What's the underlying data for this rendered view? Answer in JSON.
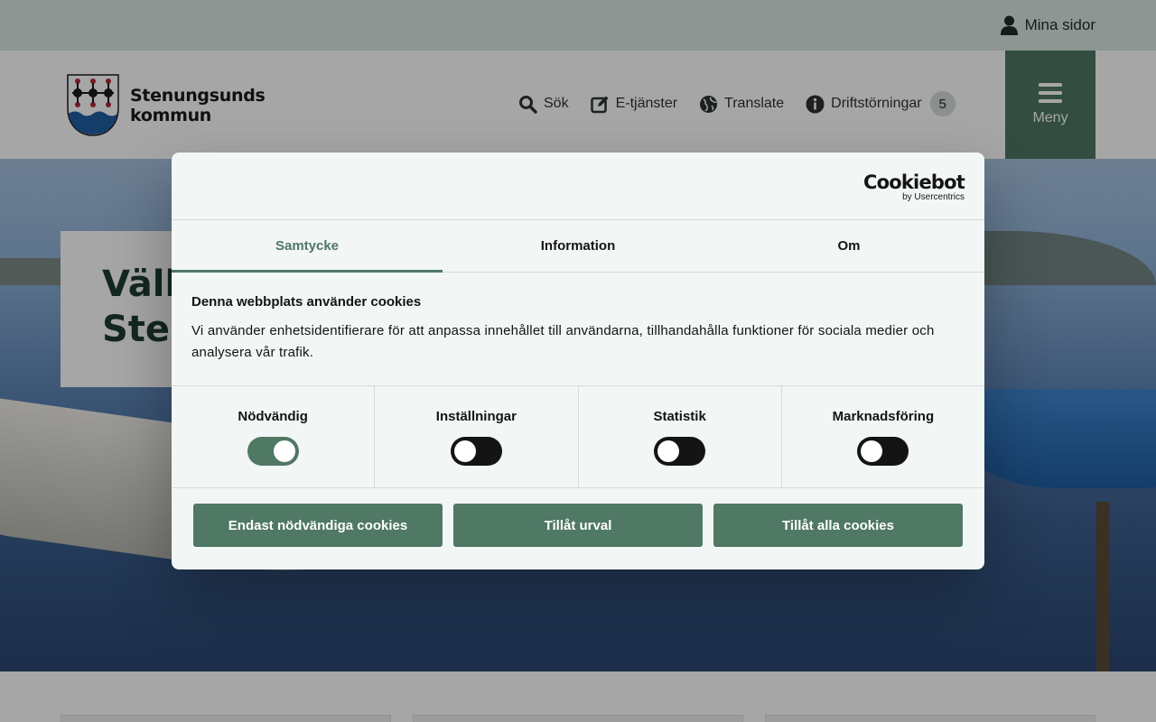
{
  "topbar": {
    "mina_sidor": "Mina sidor"
  },
  "logo": {
    "line1": "Stenungsunds",
    "line2": "kommun"
  },
  "nav": {
    "items": [
      {
        "label": "Sök",
        "icon": "search-icon"
      },
      {
        "label": "E-tjänster",
        "icon": "edit-icon"
      },
      {
        "label": "Translate",
        "icon": "globe-icon"
      },
      {
        "label": "Driftstörningar",
        "icon": "info-icon"
      }
    ],
    "driftstorningar_count": "5",
    "menu_label": "Meny"
  },
  "hero": {
    "line1": "Välk",
    "line2": "Sten"
  },
  "cookie": {
    "brand": "Cookiebot",
    "brand_sub": "by Usercentrics",
    "tabs": [
      "Samtycke",
      "Information",
      "Om"
    ],
    "active_tab": "Samtycke",
    "heading": "Denna webbplats använder cookies",
    "text": "Vi använder enhetsidentifierare för att anpassa innehållet till användarna, tillhandahålla funktioner för sociala medier och analysera vår trafik.",
    "toggles": [
      {
        "label": "Nödvändig",
        "on": true
      },
      {
        "label": "Inställningar",
        "on": false
      },
      {
        "label": "Statistik",
        "on": false
      },
      {
        "label": "Marknadsföring",
        "on": false
      }
    ],
    "buttons": [
      "Endast nödvändiga cookies",
      "Tillåt urval",
      "Tillåt alla cookies"
    ]
  },
  "colors": {
    "accent": "#4f7865",
    "dialog_bg": "#f2f6f5",
    "topbar": "#dbe6e2"
  }
}
